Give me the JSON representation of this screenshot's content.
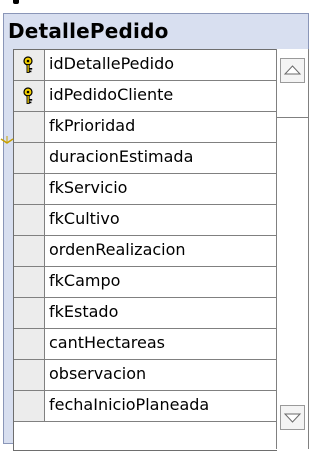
{
  "table": {
    "title": "DetallePedido",
    "fields": [
      {
        "name": "idDetallePedido",
        "key": true
      },
      {
        "name": "idPedidoCliente",
        "key": true
      },
      {
        "name": "fkPrioridad",
        "key": false
      },
      {
        "name": "duracionEstimada",
        "key": false
      },
      {
        "name": "fkServicio",
        "key": false
      },
      {
        "name": "fkCultivo",
        "key": false
      },
      {
        "name": "ordenRealizacion",
        "key": false
      },
      {
        "name": "fkCampo",
        "key": false
      },
      {
        "name": "fkEstado",
        "key": false
      },
      {
        "name": "cantHectareas",
        "key": false
      },
      {
        "name": "observacion",
        "key": false
      },
      {
        "name": "fechaInicioPlaneada",
        "key": false
      }
    ]
  },
  "icons": {
    "primary_key": "key-icon",
    "scroll_up": "triangle-up-icon",
    "scroll_down": "triangle-down-icon",
    "relationship": "relationship-connector-icon"
  },
  "colors": {
    "key_fill": "#f4d000",
    "header_bg": "#d8dff0",
    "selector_bg": "#ececec"
  }
}
